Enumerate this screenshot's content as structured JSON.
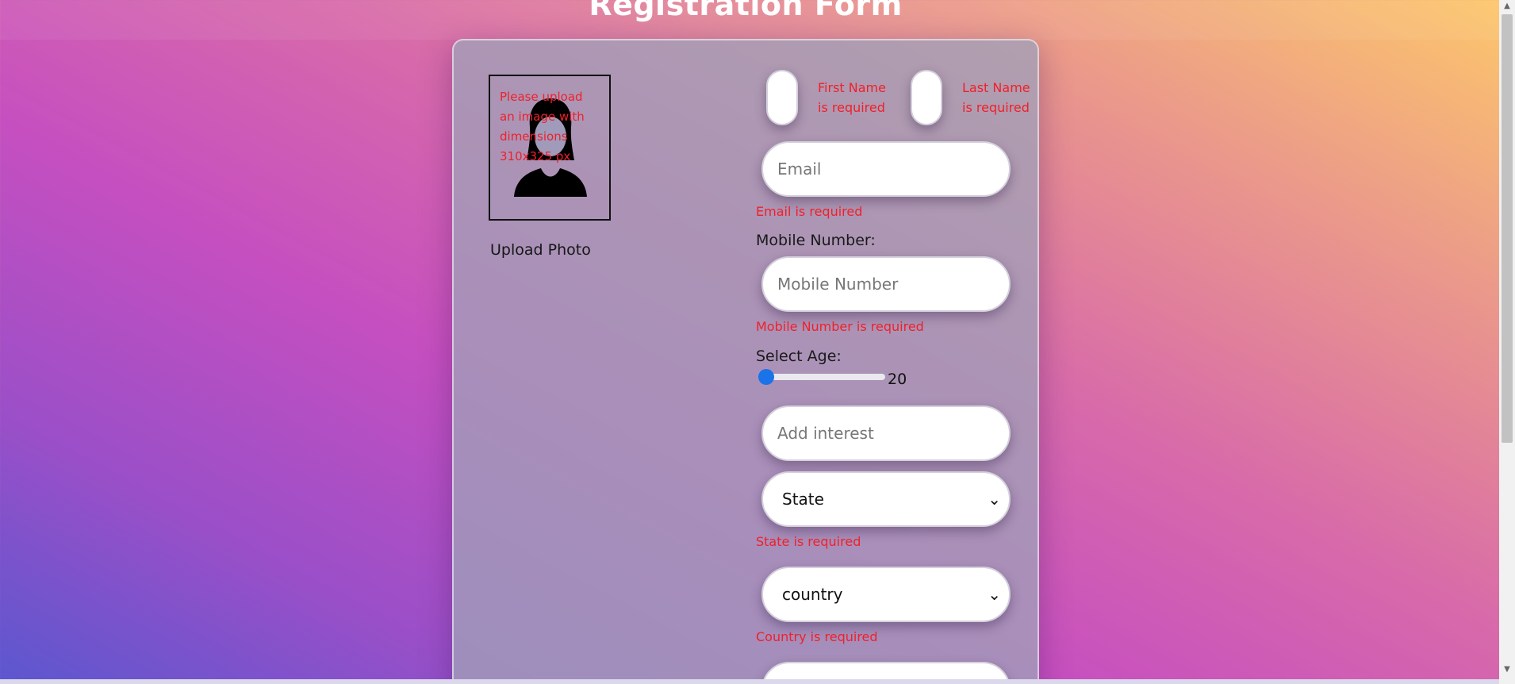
{
  "page": {
    "title": "Registration Form"
  },
  "photo": {
    "error": "Please upload an image with dimensions 310x325 px",
    "upload_label": "Upload Photo"
  },
  "name": {
    "first_error": "First Name is required",
    "last_error": "Last Name is required"
  },
  "email": {
    "placeholder": "Email",
    "error": "Email is required"
  },
  "mobile": {
    "label": "Mobile Number:",
    "placeholder": "Mobile Number",
    "error": "Mobile Number is required"
  },
  "age": {
    "label": "Select Age:",
    "value": "20",
    "level": 0.0
  },
  "interest": {
    "placeholder": "Add interest"
  },
  "state": {
    "selected": "State",
    "error": "State is required"
  },
  "country": {
    "selected": "country",
    "error": "Country is required"
  },
  "icons": {
    "avatar": "person-avatar-icon",
    "dropdown": "chevron-down-icon"
  }
}
